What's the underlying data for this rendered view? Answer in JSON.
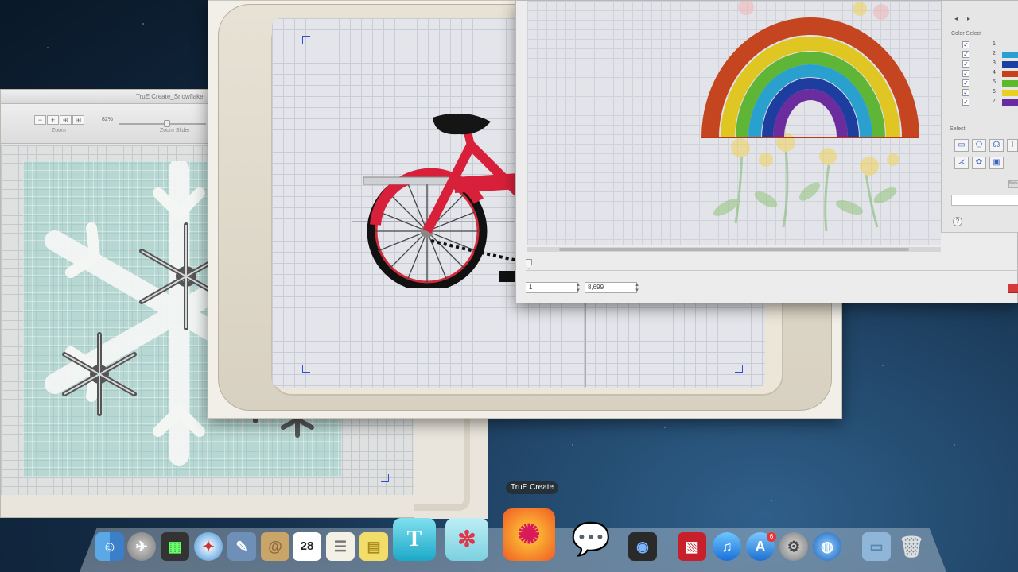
{
  "snowflake_window": {
    "title": "TruE Create_Snowflake",
    "zoom_value": "82%",
    "zoom_label": "Zoom",
    "zoom_slider_label": "Zoom Slider"
  },
  "rainbow_window": {
    "color_select_label": "Color Select",
    "select_label": "Select",
    "notes_label": "Note",
    "stepper_left_value": "1",
    "stepper_right_value": "8,699",
    "help_label": "?",
    "colors": [
      {
        "num": "1",
        "hex": "#e6e6e6"
      },
      {
        "num": "2",
        "hex": "#2aa0d0"
      },
      {
        "num": "3",
        "hex": "#1a3fa0"
      },
      {
        "num": "4",
        "hex": "#c8401a"
      },
      {
        "num": "5",
        "hex": "#5db82a"
      },
      {
        "num": "6",
        "hex": "#e8d020"
      },
      {
        "num": "7",
        "hex": "#6a2aa0"
      }
    ]
  },
  "dock": {
    "tooltip": "TruE Create",
    "calendar_day": "28",
    "text_app_letter": "T",
    "app_store_badge": "6",
    "items": [
      "finder-icon",
      "launchpad-icon",
      "photo-booth-icon",
      "safari-icon",
      "preview-icon",
      "contacts-icon",
      "calendar-icon",
      "notes-icon",
      "stickies-icon",
      "true-text-icon",
      "true-snowflake-icon",
      "true-create-icon",
      "messages-icon",
      "facetime-icon",
      "photo-app-icon",
      "itunes-icon",
      "app-store-icon",
      "system-preferences-icon",
      "network-icon",
      "folder-icon",
      "trash-icon"
    ]
  }
}
